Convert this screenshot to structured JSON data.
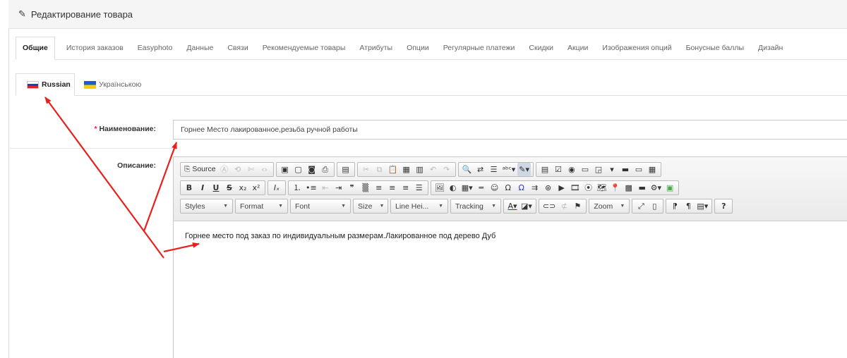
{
  "header": {
    "title": "Редактирование товара",
    "icon": "pencil-icon"
  },
  "tabs": [
    {
      "label": "Общие",
      "active": true
    },
    {
      "label": "История заказов"
    },
    {
      "label": "Easyphoto"
    },
    {
      "label": "Данные"
    },
    {
      "label": "Связи"
    },
    {
      "label": "Рекомендуемые товары"
    },
    {
      "label": "Атрибуты"
    },
    {
      "label": "Опции"
    },
    {
      "label": "Регулярные платежи"
    },
    {
      "label": "Скидки"
    },
    {
      "label": "Акции"
    },
    {
      "label": "Изображения опций"
    },
    {
      "label": "Бонусные баллы"
    },
    {
      "label": "Дизайн"
    }
  ],
  "languages": [
    {
      "label": "Russian",
      "flag": "russia-flag-icon",
      "active": true
    },
    {
      "label": "Українською",
      "flag": "ukraine-flag-icon"
    }
  ],
  "form": {
    "name_required_mark": "*",
    "name_label": "Наименование:",
    "name_value": "Горнее Место лакированное,резьба ручной работы",
    "description_label": "Описание:"
  },
  "editor": {
    "source_label": "Source",
    "combos": {
      "styles": "Styles",
      "format": "Format",
      "font": "Font",
      "size": "Size",
      "line_height": "Line Hei...",
      "tracking": "Tracking",
      "zoom": "Zoom"
    },
    "help": "?",
    "content": "Горнее место под заказ по индивидуальным размерам.Лакированное под дерево Дуб"
  },
  "annotation_color": "#e8211c"
}
